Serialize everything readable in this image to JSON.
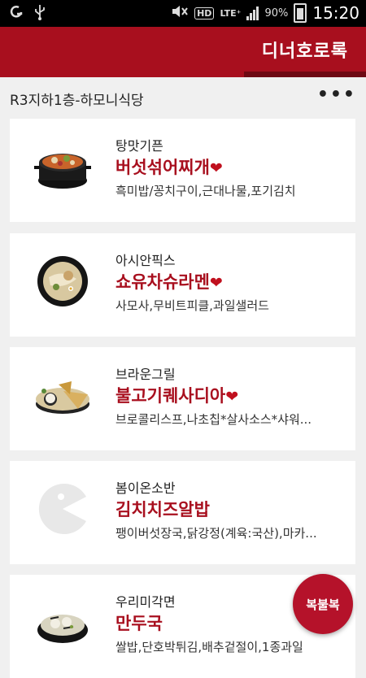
{
  "status_bar": {
    "battery_percent": "90%",
    "time": "15:20",
    "hd": "HD",
    "lte": "LTE⁺"
  },
  "app_bar": {
    "title": "디너호로록"
  },
  "location": {
    "label": "R3지하1층-하모니식당",
    "more": "•••"
  },
  "menus": [
    {
      "restaurant": "탕맛기픈",
      "dish": "버섯섞어찌개",
      "heart": "❤",
      "sides": "흑미밥/꽁치구이,근대나물,포기김치"
    },
    {
      "restaurant": "아시안픽스",
      "dish": "쇼유차슈라멘",
      "heart": "❤",
      "sides": "사모사,무비트피클,과일샐러드"
    },
    {
      "restaurant": "브라운그릴",
      "dish": "불고기퀘사디아",
      "heart": "❤",
      "sides": "브로콜리스프,나초칩*살사소스*샤워..."
    },
    {
      "restaurant": "봄이온소반",
      "dish": "김치치즈알밥",
      "heart": "",
      "sides": "팽이버섯장국,닭강정(계육:국산),마카..."
    },
    {
      "restaurant": "우리미각면",
      "dish": "만두국",
      "heart": "",
      "sides": "쌀밥,단호박튀김,배추겉절이,1종과일"
    }
  ],
  "fab": {
    "label": "복불복"
  }
}
